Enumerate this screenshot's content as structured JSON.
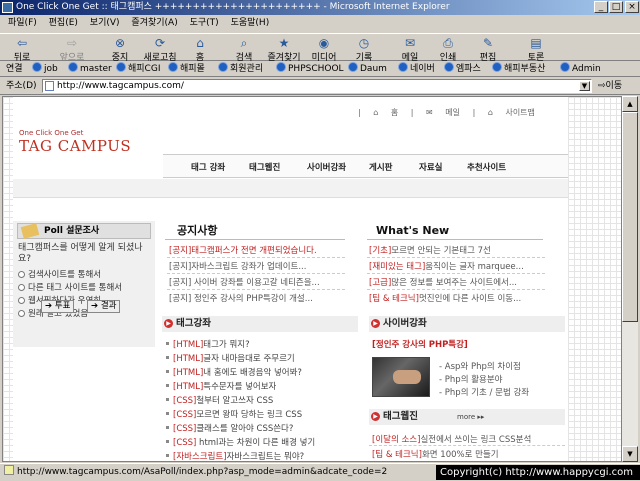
{
  "window": {
    "title": "One Click One Get :: 태그캠퍼스 ++++++++++++++++++++++ - Microsoft Internet Explorer",
    "controls": [
      "_",
      "□",
      "×"
    ]
  },
  "menu": [
    "파일(F)",
    "편집(E)",
    "보기(V)",
    "즐겨찾기(A)",
    "도구(T)",
    "도움말(H)"
  ],
  "toolbar": {
    "back": "뒤로",
    "forward": "앞으로",
    "stop": "중지",
    "refresh": "새로고침",
    "home": "홈",
    "search": "검색",
    "favorites": "즐겨찾기",
    "media": "미디어",
    "history": "기록",
    "mail": "메일",
    "print": "인쇄",
    "edit": "편집",
    "discuss": "토론"
  },
  "links": {
    "label": "연결",
    "items": [
      "job",
      "master",
      "해피CGI",
      "해피몰",
      "회원관리",
      "PHPSCHOOL",
      "Daum",
      "네이버",
      "엠파스",
      "해피부동산",
      "Admin"
    ]
  },
  "address": {
    "label": "주소(D)",
    "url": "http://www.tagcampus.com/",
    "go": "이동"
  },
  "page": {
    "topnav": [
      "홈",
      "메일",
      "사이트맵"
    ],
    "logo_small": "One Click  One Get",
    "logo": "TAG CAMPUS",
    "nav": [
      "태그 강좌",
      "태그웹진",
      "사이버강좌",
      "게시판",
      "자료실",
      "추천사이트"
    ],
    "poll": {
      "title": "Poll 설문조사",
      "question": "태그캠퍼스를 어떻게 알게 되셨나요?",
      "options": [
        "검색사이트를 통해서",
        "다른 태그 사이트를 통해서",
        "웹서핑하다가 우연히",
        "원래 알고 있었음"
      ],
      "vote": "투표",
      "result": "결과"
    },
    "notice": {
      "title": "공지사항",
      "items": [
        "[공지]태그캠퍼스가 전면 개편되었습니다.",
        "[공지]자바스크립트 강좌가 업데이트...",
        "[공지] 사이버 강좌를 이용고갈 네티즌을...",
        "[공지] 정인주 강사의 PHP특강이 개설..."
      ]
    },
    "whatsnew": {
      "title": "What's New",
      "items": [
        {
          "tag": "[기초]",
          "text": "모르면 안되는 기본태그 7선"
        },
        {
          "tag": "[재미있는 태그]",
          "text": "움직이는 글자 marquee..."
        },
        {
          "tag": "[고급]",
          "text": "많은 정보를 보여주는 사이트에서..."
        },
        {
          "tag": "[팁 & 테크닉]",
          "text": "멋진인에 다른 사이트 이동..."
        }
      ]
    },
    "tagclass": {
      "title": "태그강좌",
      "items": [
        {
          "tag": "[HTML]",
          "text": "태그가 뭐지?"
        },
        {
          "tag": "[HTML]",
          "text": "글자 내마음대로 주무르기"
        },
        {
          "tag": "[HTML]",
          "text": "내 홈에도 배경음악 넣어봐?"
        },
        {
          "tag": "[HTML]",
          "text": "특수문자를 넣어보자"
        },
        {
          "tag": "[CSS]",
          "text": "철부터 알고쓰자 CSS"
        },
        {
          "tag": "[CSS]",
          "text": "모르면 왕따 당하는 링크 CSS"
        },
        {
          "tag": "[CSS]",
          "text": "클래스를 알아야 CSS쓴다?"
        },
        {
          "tag": "[CSS]",
          "text": " html과는 차원이 다른 배경 넣기"
        },
        {
          "tag": "[자바스크립트]",
          "text": "자바스크립트는 뭐야?"
        }
      ]
    },
    "cyber": {
      "title": "사이버강좌",
      "banner": "[정인주 강사의 PHP특강]",
      "items": [
        "Asp와 Php의 차이점",
        "Php의 활용분야",
        "Php의 기초 / 문법 강좌"
      ]
    },
    "webzine": {
      "title": "태그웹진",
      "more": "more",
      "items": [
        {
          "tag": "[이달의 소스]",
          "text": "실전에서 쓰이는 링크 CSS분석"
        },
        {
          "tag": "[팁 & 테크닉]",
          "text": "화면 100%로 만들기"
        }
      ]
    }
  },
  "status": {
    "text": "http://www.tagcampus.com/AsaPoll/index.php?asp_mode=admin&adcate_code=2",
    "copyright": "Copyright(c) http://www.happycgi.com"
  }
}
